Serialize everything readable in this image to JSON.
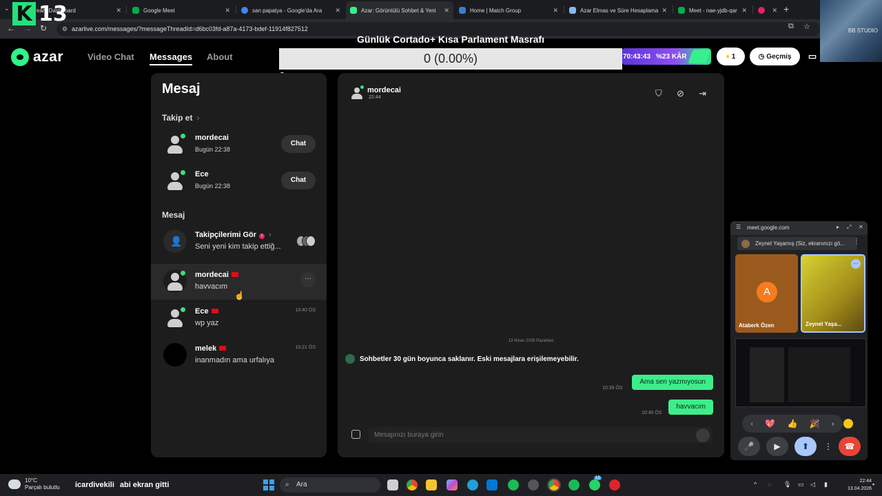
{
  "browser": {
    "tabs": [
      {
        "label": "stream Dashboard",
        "color": "#53fc18"
      },
      {
        "label": "Google Meet",
        "color": "#00ac47"
      },
      {
        "label": "san papatya - Google'da Ara",
        "color": "#4285f4"
      },
      {
        "label": "Azar: Görüntülü Sohbet & Yeni",
        "color": "#2ef48a"
      },
      {
        "label": "Home | Match Group",
        "color": "#3a7bd5"
      },
      {
        "label": "Azar Elmas ve Süre Hesaplama",
        "color": "#8ab4f8"
      },
      {
        "label": "Meet - nae-yjdb-qar",
        "color": "#00ac47"
      },
      {
        "label": "",
        "color": "#e0245e"
      }
    ],
    "url": "azarlive.com/messages/?messageThreadId=d6bc03fd-a87a-4173-bdef-11914f827512"
  },
  "stream": {
    "logo_letter": "K",
    "logo_number": "13",
    "webcam_watermark": "BB STUDIO"
  },
  "overlay": {
    "title": "Günlük Cortado+ Kısa Parlament Masrafı",
    "bar_value": "0 (0.00%)",
    "bar_fraction": 0,
    "min_label": "0",
    "max_label": "1"
  },
  "header": {
    "logo": "azar",
    "nav": [
      "Video Chat",
      "Messages",
      "About"
    ],
    "promo_timer": "70:43:43",
    "promo_discount": "%23 KÂR",
    "gems": "1",
    "history_label": "Geçmiş"
  },
  "left": {
    "title": "Mesaj",
    "follow_section": "Takip et",
    "follow_items": [
      {
        "name": "mordecai",
        "sub": "Bugün 22:38",
        "btn": "Chat"
      },
      {
        "name": "Ece",
        "sub": "Bugün 22:38",
        "btn": "Chat"
      }
    ],
    "message_section": "Mesaj",
    "followers": {
      "title": "Takipçilerimi Gör",
      "badge": "!",
      "sub": "Seni yeni kim takip ettiğ..."
    },
    "threads": [
      {
        "name": "mordecai",
        "msg": "havvacım",
        "time": "",
        "more": "···"
      },
      {
        "name": "Ece",
        "msg": "wp yaz",
        "time": "10:40 ÖS"
      },
      {
        "name": "melek",
        "msg": "inanmadın ama urfalıya",
        "time": "10:21 ÖS"
      }
    ]
  },
  "chat": {
    "name": "mordecai",
    "time": "22:44",
    "date_separator": "13 Nisan 2026 Pazartesi",
    "system_msg": "Sohbetler 30 gün boyunca saklanır. Eski mesajlara erişilemeyebilir.",
    "messages": [
      {
        "text": "Ama sen yazmıyosun",
        "time": "10:39 ÖS"
      },
      {
        "text": "havvacım",
        "time": "10:40 ÖS"
      }
    ],
    "input_placeholder": "Mesajınızı buraya girin"
  },
  "meet": {
    "url": "meet.google.com",
    "presenting": "Zeynel Yaşamış (Siz, ekranınızı gö...",
    "tile_a_initial": "A",
    "tile_a_name": "Ataberk Özen",
    "tile_b_name": "Zeynel Yaşa...",
    "emojis": [
      "💖",
      "👍",
      "🎉"
    ]
  },
  "taskbar": {
    "temp": "10°C",
    "weather": "Parçalı bulutlu",
    "chat_user": "icardivekili",
    "chat_msg": "abi ekran gitti",
    "search": "Ara",
    "time": "22:44",
    "date": "13.04.2026",
    "whatsapp_badge": "15"
  }
}
